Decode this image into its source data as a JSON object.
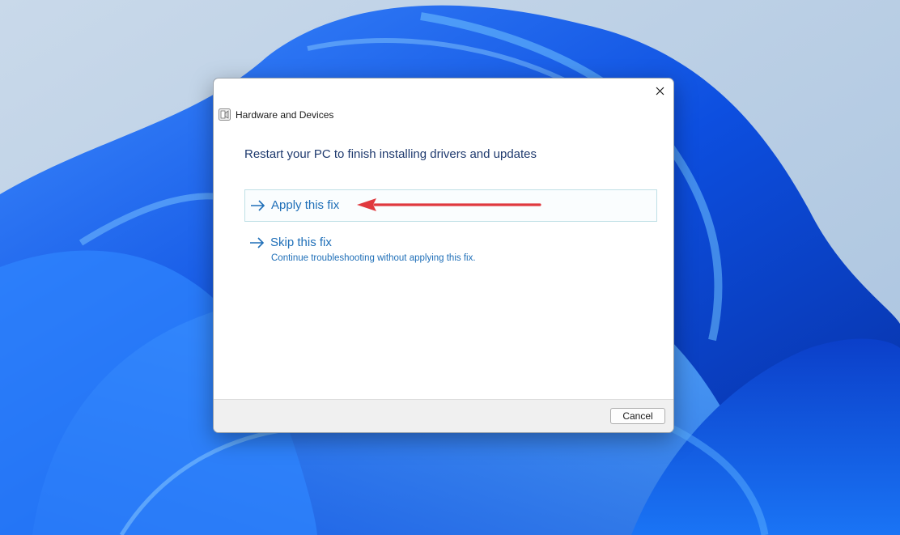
{
  "wallpaper": {
    "colors": {
      "sky": "#b9cfe6",
      "deep_blue": "#0a3fc4",
      "mid_blue": "#1667f0",
      "light_blue": "#58b6ff"
    }
  },
  "dialog": {
    "window_title": "Hardware and Devices",
    "app_icon": "troubleshooter-icon",
    "close_icon": "close-icon",
    "heading": "Restart your PC to finish installing drivers and updates",
    "options": [
      {
        "icon": "arrow-right-icon",
        "label": "Apply this fix"
      },
      {
        "icon": "arrow-right-icon",
        "label": "Skip this fix",
        "description": "Continue troubleshooting without applying this fix."
      }
    ],
    "annotation": {
      "icon": "red-arrow-pointer",
      "color": "#e0393e"
    },
    "footer": {
      "cancel_label": "Cancel"
    },
    "colors": {
      "heading": "#1f3a6e",
      "link": "#1f6fb8",
      "highlight_border": "#bfe0e6",
      "footer_bg": "#f0f0f0"
    }
  }
}
